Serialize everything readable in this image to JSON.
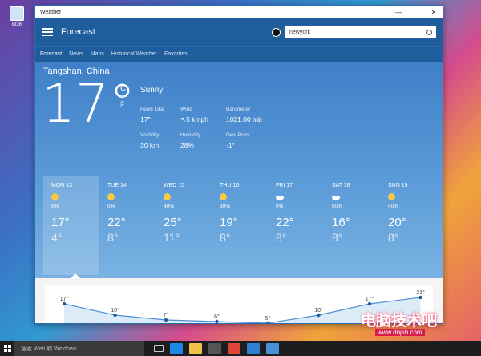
{
  "desktop": {
    "icon_label": "Bl36"
  },
  "window": {
    "title": "Weather",
    "min": "—",
    "max": "☐",
    "close": "✕"
  },
  "header": {
    "title": "Forecast",
    "search_value": "newyork"
  },
  "nav": [
    "Forecast",
    "News",
    "Maps",
    "Historical Weather",
    "Favorites"
  ],
  "current": {
    "location": "Tangshan, China",
    "temp": "17°",
    "unit_c": "C",
    "unit_f": "F",
    "condition": "Sunny",
    "details": [
      {
        "label": "Feels Like",
        "value": "17°"
      },
      {
        "label": "Wind",
        "value": "↖5 kmph"
      },
      {
        "label": "Barometer",
        "value": "1021.00 mb"
      },
      {
        "label": "Visibility",
        "value": "30 km"
      },
      {
        "label": "Humidity",
        "value": "28%"
      },
      {
        "label": "Dew Point",
        "value": "-1°"
      }
    ]
  },
  "days": [
    {
      "name": "MON 13",
      "icon": "sun-icon",
      "precip": "0%",
      "hi": "17°",
      "lo": "4°"
    },
    {
      "name": "TUE 14",
      "icon": "sun-icon",
      "precip": "0%",
      "hi": "22°",
      "lo": "8°"
    },
    {
      "name": "WED 15",
      "icon": "sun-icon",
      "precip": "40%",
      "hi": "25°",
      "lo": "11°"
    },
    {
      "name": "THU 16",
      "icon": "sun-icon",
      "precip": "30%",
      "hi": "19°",
      "lo": "8°"
    },
    {
      "name": "FRI 17",
      "icon": "cloud-icon",
      "precip": "0%",
      "hi": "22°",
      "lo": "8°"
    },
    {
      "name": "SAT 18",
      "icon": "cloud-icon",
      "precip": "50%",
      "hi": "16°",
      "lo": "8°"
    },
    {
      "name": "SUN 19",
      "icon": "sun-icon",
      "precip": "40%",
      "hi": "20°",
      "lo": "8°"
    }
  ],
  "hourly_chart": {
    "labels": [
      "17°",
      "10°",
      "7°",
      "6°",
      "5°",
      "10°",
      "17°",
      "21°"
    ],
    "values": [
      17,
      10,
      7,
      6,
      5,
      10,
      17,
      21
    ]
  },
  "taskbar": {
    "search_placeholder": "搜索 Web 和 Windows"
  },
  "watermark": {
    "title": "电脑技术吧",
    "url": "www.dnjsb.com"
  }
}
